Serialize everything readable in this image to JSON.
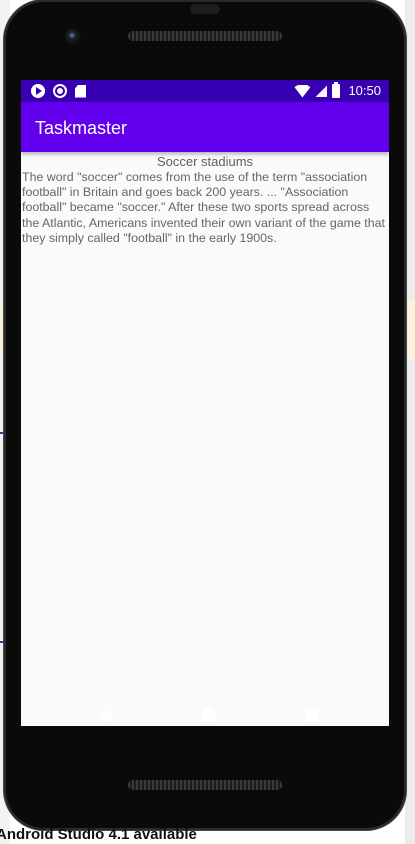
{
  "desktop": {
    "notification": "Android Studio 4.1 available"
  },
  "status_bar": {
    "time": "10:50",
    "left_icons": [
      "play-protect-icon",
      "sync-circle-icon",
      "sd-card-icon"
    ],
    "right_icons": [
      "wifi-icon",
      "cellular-signal-icon",
      "battery-icon"
    ],
    "color": "#3700b3"
  },
  "app_bar": {
    "title": "Taskmaster",
    "color": "#6200ee"
  },
  "task": {
    "title": "Soccer stadiums",
    "body": "The word \"soccer\" comes from the use of the term \"association football\" in Britain and goes back 200 years. ... \"Association football\" became \"soccer.\" After these two sports spread across the Atlantic, Americans invented their own variant of the game that they simply called \"football\" in the early 1900s."
  },
  "nav_bar": {
    "icons": [
      "back-icon",
      "home-icon",
      "recents-icon"
    ]
  }
}
